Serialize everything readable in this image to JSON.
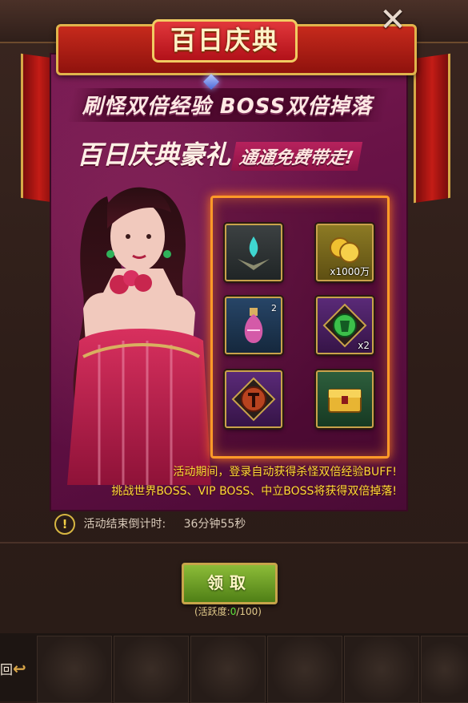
{
  "window": {
    "title": "百日庆典",
    "close_label": "✕"
  },
  "banner": {
    "headline": "刷怪双倍经验   BOSS双倍掉落",
    "subheadline_main": "百日庆典豪礼",
    "subheadline_tag": "通通免费带走!"
  },
  "rewards": [
    {
      "name": "teal-flame-emblem",
      "qty": ""
    },
    {
      "name": "gold-coins",
      "qty": "x1000万"
    },
    {
      "name": "pink-potion",
      "sup": "2"
    },
    {
      "name": "green-armor-gem",
      "qty": "x2"
    },
    {
      "name": "red-rune-medallion",
      "qty": ""
    },
    {
      "name": "golden-treasure-chest",
      "qty": ""
    }
  ],
  "info": {
    "line1": "活动期间，登录自动获得杀怪双倍经验BUFF!",
    "line2": "挑战世界BOSS、VIP BOSS、中立BOSS将获得双倍掉落!"
  },
  "countdown": {
    "label": "活动结束倒计时:",
    "value": "36分钟55秒"
  },
  "claim": {
    "label": "领取"
  },
  "activity": {
    "prefix": "(活跃度:",
    "current": "0",
    "max": "/100)"
  },
  "bottom": {
    "return_label": "回"
  },
  "colors": {
    "panel": "#6a1347",
    "reward_border": "#ff9a28",
    "info_text": "#ffd83a",
    "claim_button": "#6a9a26",
    "title_banner": "#c62a1c"
  }
}
